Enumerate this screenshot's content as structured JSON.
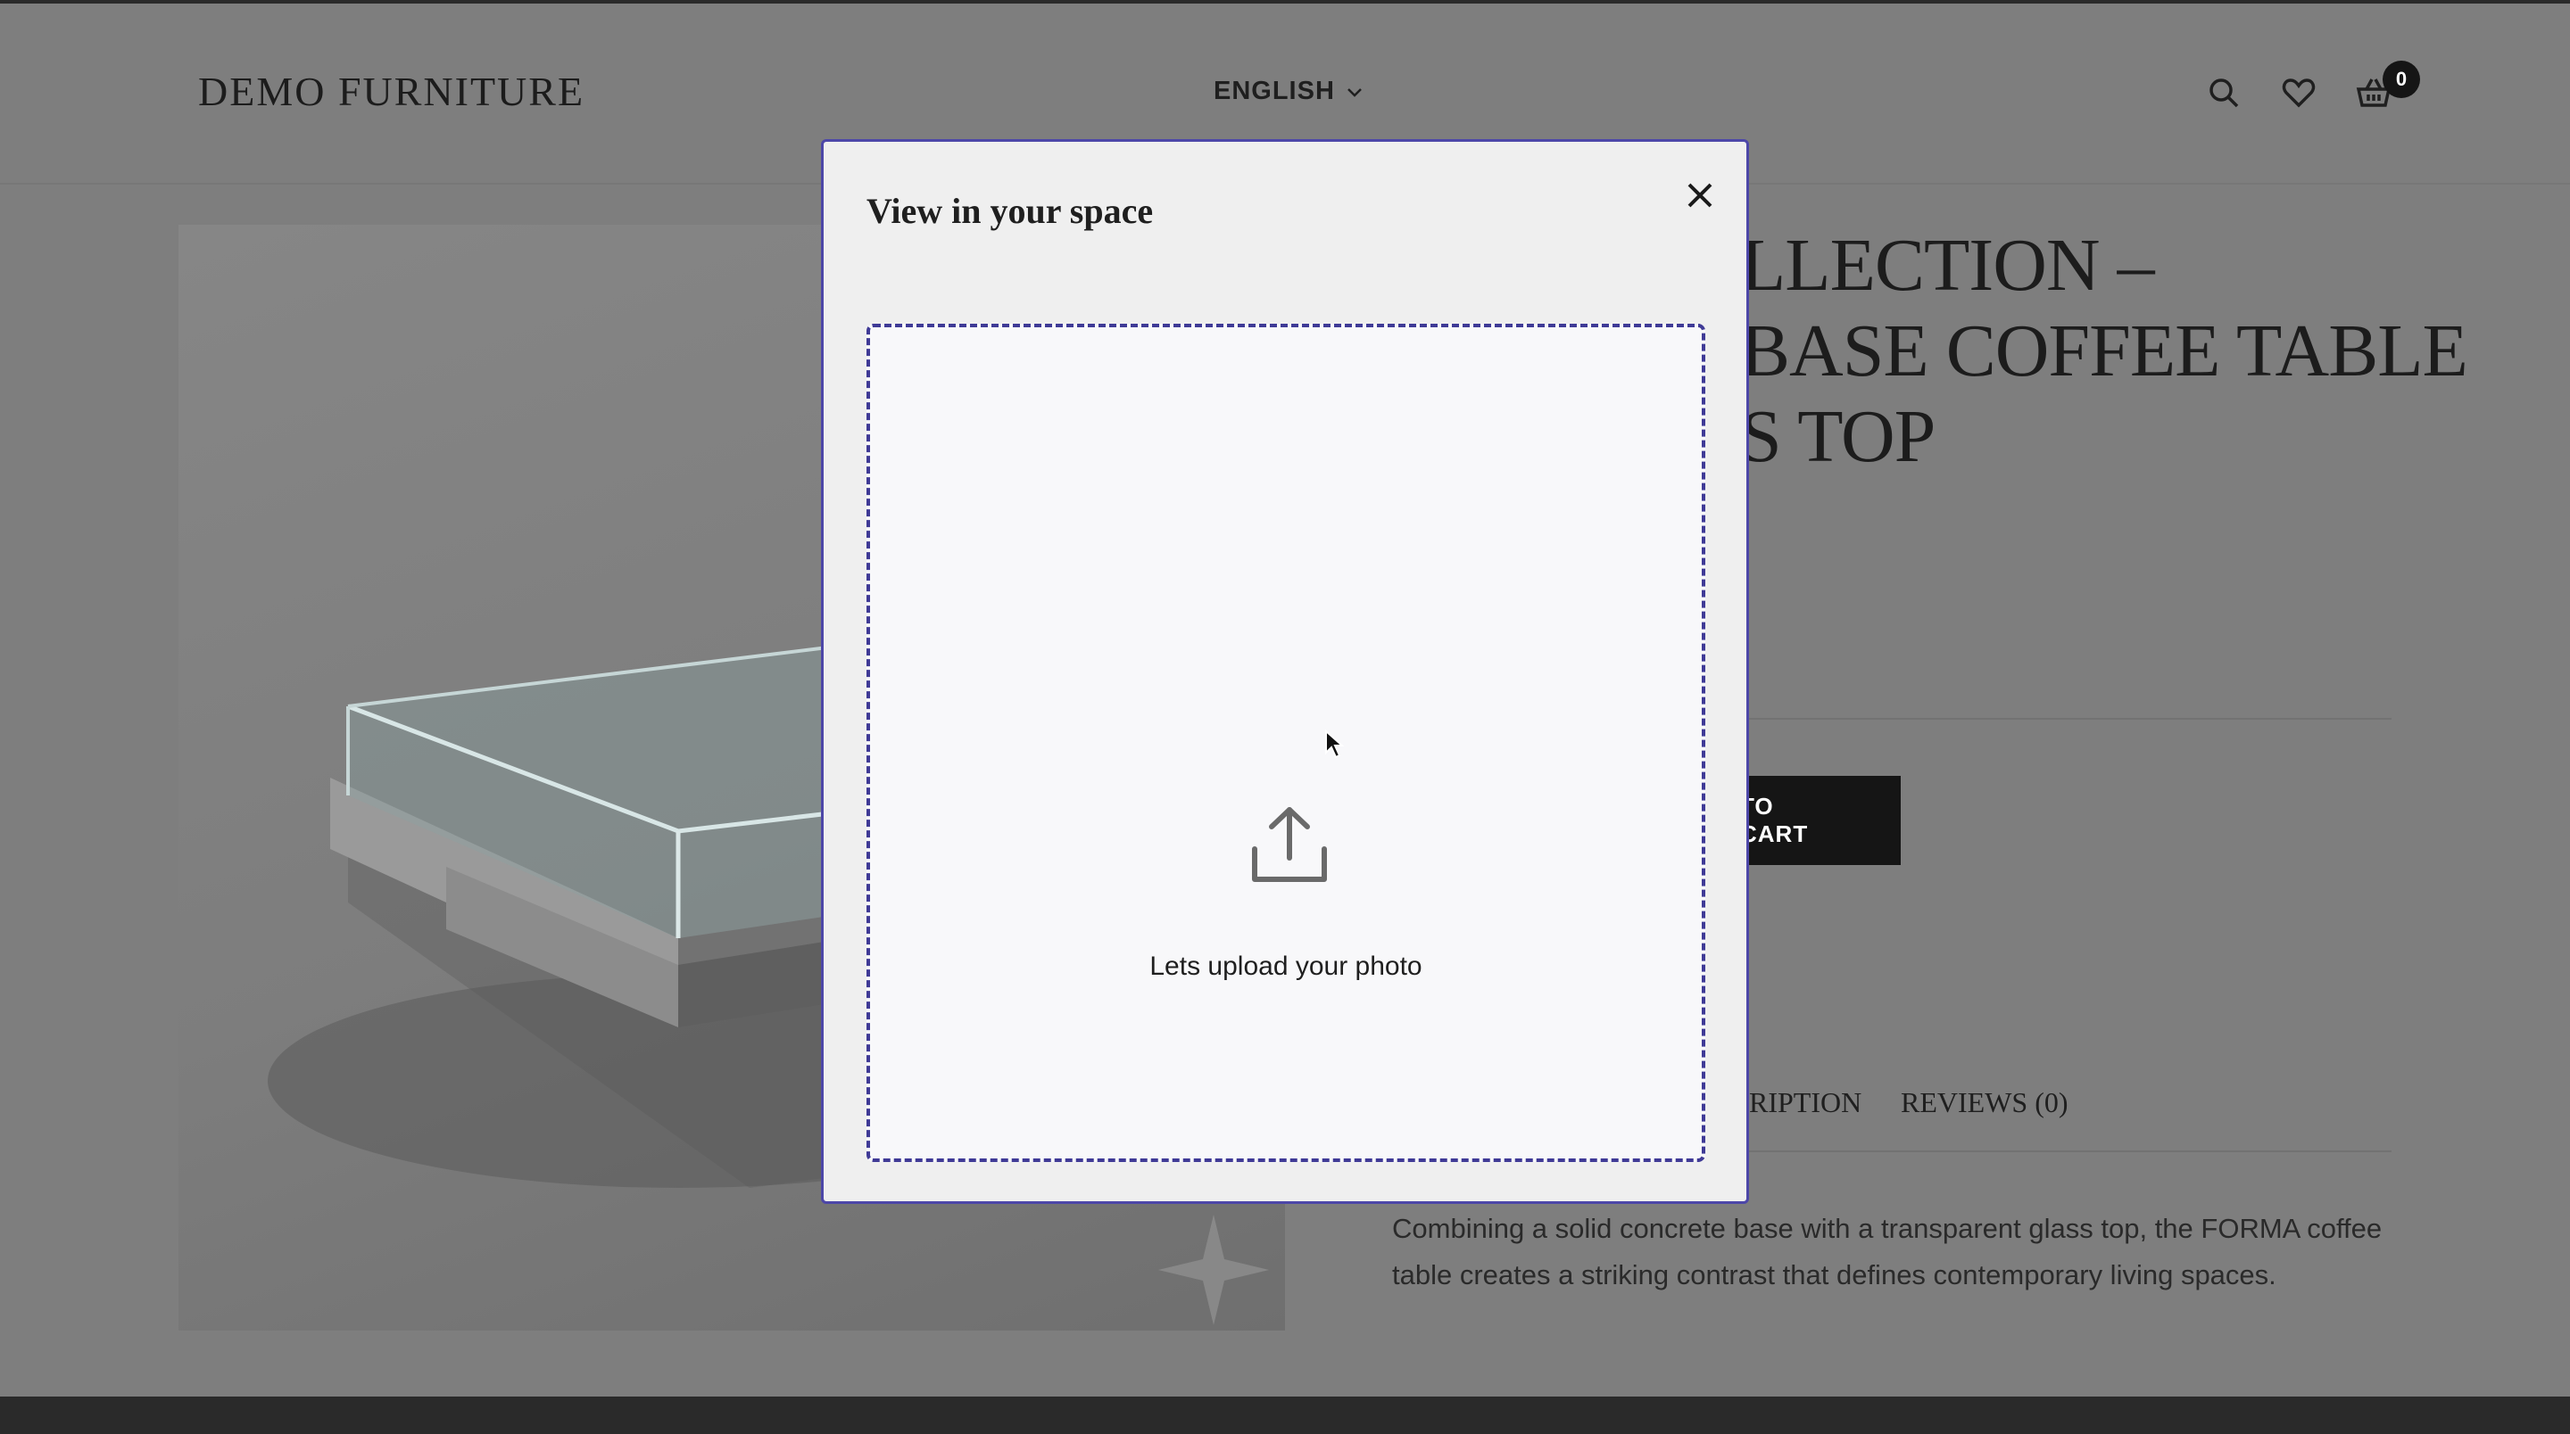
{
  "header": {
    "logo": "DEMO FURNITURE",
    "language": "ENGLISH",
    "cart_count": "0",
    "icons": [
      "search-icon",
      "heart-icon",
      "basket-icon",
      "chevron-down-icon"
    ]
  },
  "product": {
    "title_lines": [
      "LLECTION –",
      "BASE COFFEE TABLE",
      "S TOP"
    ],
    "add_to_cart": "TO CART",
    "tabs": {
      "description": "RIPTION",
      "reviews": "REVIEWS (0)"
    },
    "description": "Combining a solid concrete base with a transparent glass top, the FORMA coffee table creates a striking contrast that defines contemporary living spaces."
  },
  "modal": {
    "title": "View in your space",
    "upload_text": "Lets upload your photo",
    "icons": [
      "close-icon",
      "upload-icon"
    ]
  },
  "colors": {
    "overlay": "#7e7e7e",
    "modal_border": "#4d47a8",
    "dropzone_border": "#3f3a96",
    "modal_bg": "#efefef"
  }
}
